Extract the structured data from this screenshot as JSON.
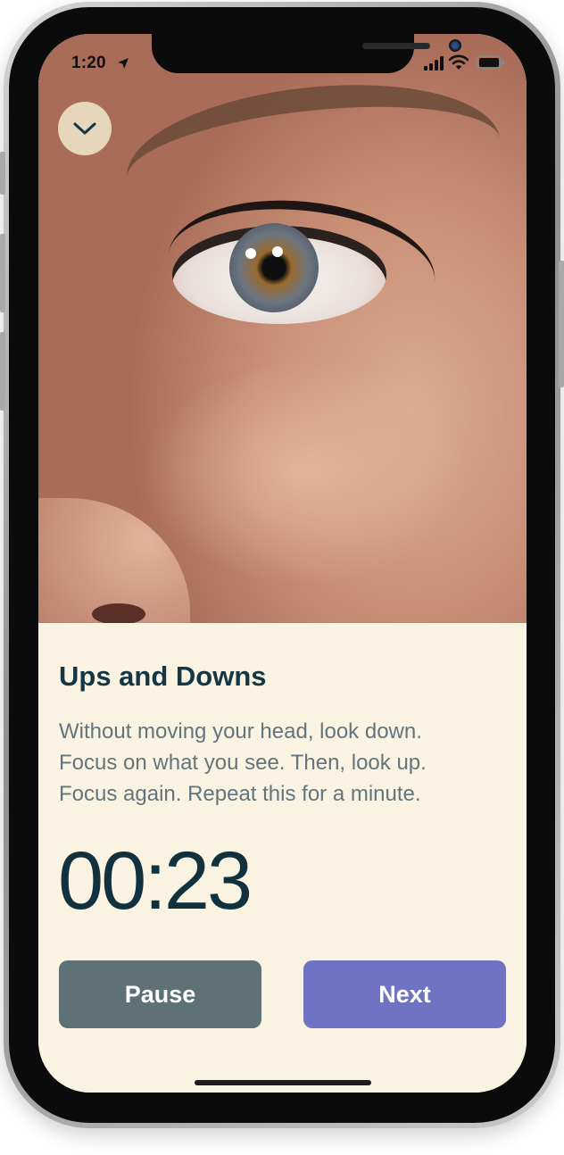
{
  "status_bar": {
    "time": "1:20",
    "icons": [
      "location-arrow-icon",
      "cellular-signal-icon",
      "wifi-icon",
      "battery-icon"
    ]
  },
  "header": {
    "collapse_icon": "chevron-down-icon"
  },
  "hero_image": {
    "subject": "eye-closeup-photo"
  },
  "exercise": {
    "title": "Ups and Downs",
    "description_lines": [
      "Without moving your head, look down.",
      "Focus on what you see. Then, look up.",
      "Focus again. Repeat this for a minute."
    ],
    "timer": "00:23"
  },
  "actions": {
    "pause_label": "Pause",
    "next_label": "Next"
  },
  "colors": {
    "background": "#fbf3e2",
    "title": "#153745",
    "body_text": "#62757e",
    "pause_button": "#5d7176",
    "next_button": "#6f73c3"
  }
}
